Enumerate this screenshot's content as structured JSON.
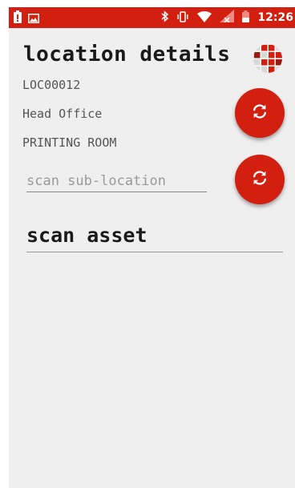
{
  "status_bar": {
    "time": "12:26",
    "icons": [
      "battery-alert-icon",
      "image-icon",
      "bluetooth-icon",
      "vibrate-icon",
      "wifi-icon",
      "no-signal-icon",
      "battery-icon"
    ]
  },
  "header": {
    "title": "location details",
    "logo_icon": "app-logo-icon"
  },
  "location": {
    "code": "LOC00012",
    "site": "Head Office",
    "room": "PRINTING ROOM"
  },
  "sub_location": {
    "placeholder": "scan sub-location",
    "refresh_icon": "refresh-icon"
  },
  "asset": {
    "placeholder": "scan asset"
  },
  "colors": {
    "accent": "#d21f0f",
    "background": "#efefef",
    "text_primary": "#1a1a1a",
    "text_secondary": "#555555"
  }
}
